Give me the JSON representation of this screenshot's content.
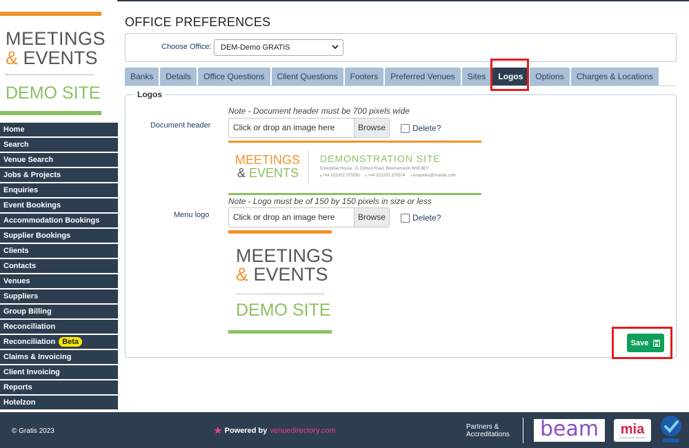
{
  "brand": {
    "line1": "MEETINGS",
    "amp": "&",
    "line2": "EVENTS",
    "line3": "DEMO SITE"
  },
  "sidebar": {
    "items": [
      {
        "label": "Home"
      },
      {
        "label": "Search"
      },
      {
        "label": "Venue Search"
      },
      {
        "label": "Jobs & Projects"
      },
      {
        "label": "Enquiries"
      },
      {
        "label": "Event Bookings"
      },
      {
        "label": "Accommodation Bookings"
      },
      {
        "label": "Supplier Bookings"
      },
      {
        "label": "Clients"
      },
      {
        "label": "Contacts"
      },
      {
        "label": "Venues"
      },
      {
        "label": "Suppliers"
      },
      {
        "label": "Group Billing"
      },
      {
        "label": "Reconciliation"
      },
      {
        "label": "Reconciliation",
        "badge": "Beta"
      },
      {
        "label": "Claims & Invoicing"
      },
      {
        "label": "Client Invoicing"
      },
      {
        "label": "Reports"
      },
      {
        "label": "Hotelzon"
      }
    ]
  },
  "page": {
    "title": "OFFICE PREFERENCES"
  },
  "office": {
    "label": "Choose Office:",
    "selected": "DEM-Demo GRATIS"
  },
  "tabs": [
    {
      "label": "Banks",
      "active": false
    },
    {
      "label": "Details",
      "active": false
    },
    {
      "label": "Office Questions",
      "active": false
    },
    {
      "label": "Client Questions",
      "active": false
    },
    {
      "label": "Footers",
      "active": false
    },
    {
      "label": "Preferred Venues",
      "active": false
    },
    {
      "label": "Sites",
      "active": false
    },
    {
      "label": "Logos",
      "active": true
    },
    {
      "label": "Options",
      "active": false
    },
    {
      "label": "Charges & Locations",
      "active": false
    }
  ],
  "logos": {
    "legend": "Logos",
    "document_header": {
      "note": "Note - Document header must be 700 pixels wide",
      "label": "Document header",
      "placeholder": "Click or drop an image here",
      "browse": "Browse",
      "delete": "Delete?",
      "preview": {
        "brand_line1": "MEETINGS",
        "brand_amp": "&",
        "brand_line2": "EVENTS",
        "site": "DEMONSTRATION SITE",
        "address": "Enterprise House, 21 Oxford Road, Bournemouth BH8 8EY",
        "phone1": "+44 (0)1202 375590",
        "phone2": "+44 (0)1202 375574",
        "email": "enquiries@mande.com"
      }
    },
    "menu_logo": {
      "note": "Note - Logo must be of 150 by 150 pixels in size or less",
      "label": "Menu logo",
      "placeholder": "Click or drop an image here",
      "browse": "Browse",
      "delete": "Delete?",
      "preview": {
        "line1": "MEETINGS",
        "amp": "&",
        "line2": "EVENTS",
        "line3": "DEMO SITE"
      }
    },
    "save_label": "Save"
  },
  "footer": {
    "copyright": "© Gratis 2023",
    "powered_by": "Powered by",
    "powered_link": "venuedirectory.com",
    "partners_line1": "Partners &",
    "partners_line2": "Accreditations",
    "beam": "beam",
    "mia": "mia",
    "mia_sub": "meetings industry association"
  },
  "colors": {
    "nav_bg": "#2d3e50",
    "tab_bg": "#a9c0d6",
    "orange": "#f0932b",
    "green": "#8cc063",
    "save_green": "#0e9f5a",
    "highlight_red": "#e01d1d"
  }
}
